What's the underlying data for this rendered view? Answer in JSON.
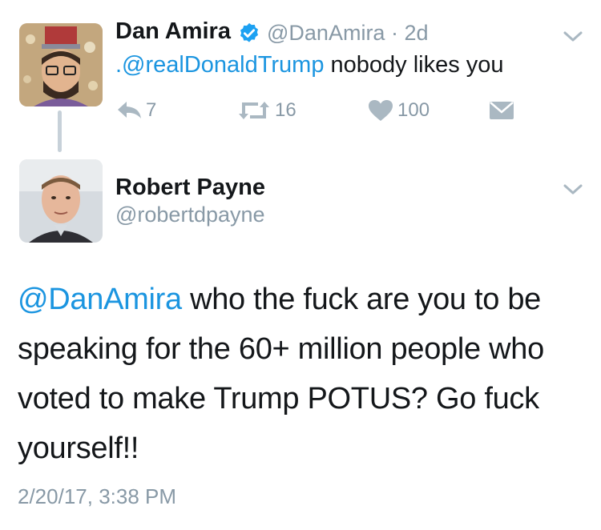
{
  "original_tweet": {
    "author_name": "Dan Amira",
    "handle": "@DanAmira",
    "separator": " · ",
    "time_ago": "2d",
    "mention": ".@realDonaldTrump",
    "text_rest": " nobody likes you",
    "actions": {
      "replies": "7",
      "retweets": "16",
      "likes": "100"
    }
  },
  "reply_tweet": {
    "author_name": "Robert Payne",
    "handle": "@robertdpayne",
    "mention": "@DanAmira",
    "text_rest": " who the fuck are you to be speaking for the 60+ million people who voted to make Trump POTUS? Go fuck yourself!!",
    "timestamp": "2/20/17, 3:38 PM"
  },
  "colors": {
    "link_blue": "#1b95e0",
    "muted_gray": "#8899a6",
    "text_dark": "#14171a",
    "verified_blue": "#1da1f2"
  }
}
